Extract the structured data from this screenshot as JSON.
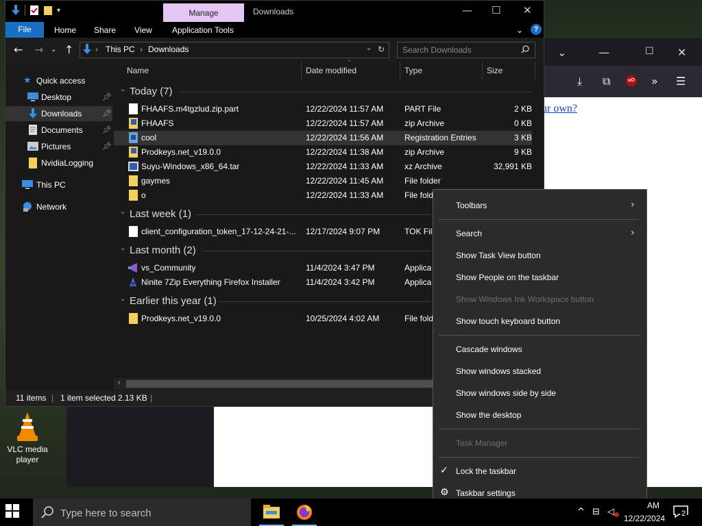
{
  "explorer": {
    "title": "Downloads",
    "manage_tab": "Manage",
    "ribbon_tabs": [
      "File",
      "Home",
      "Share",
      "View",
      "Application Tools"
    ],
    "breadcrumb": [
      "This PC",
      "Downloads"
    ],
    "search_placeholder": "Search Downloads",
    "columns": [
      "Name",
      "Date modified",
      "Type",
      "Size"
    ],
    "sidebar": [
      {
        "label": "Quick access",
        "icon": "star-icon"
      },
      {
        "label": "Desktop",
        "icon": "desktop-icon",
        "pinned": true
      },
      {
        "label": "Downloads",
        "icon": "download-icon",
        "pinned": true,
        "selected": true
      },
      {
        "label": "Documents",
        "icon": "document-icon",
        "pinned": true
      },
      {
        "label": "Pictures",
        "icon": "pictures-icon",
        "pinned": true
      },
      {
        "label": "NvidiaLogging",
        "icon": "folder-icon"
      },
      {
        "label": "This PC",
        "icon": "pc-icon"
      },
      {
        "label": "Network",
        "icon": "network-icon"
      }
    ],
    "groups": [
      {
        "label": "Today (7)",
        "files": [
          {
            "name": "FHAAFS.m4tgzlud.zip.part",
            "date": "12/22/2024 11:57 AM",
            "type": "PART File",
            "size": "2 KB",
            "icon": "file-icon"
          },
          {
            "name": "FHAAFS",
            "date": "12/22/2024 11:57 AM",
            "type": "zip Archive",
            "size": "0 KB",
            "icon": "zip-icon"
          },
          {
            "name": "cool",
            "date": "12/22/2024 11:56 AM",
            "type": "Registration Entries",
            "size": "3 KB",
            "icon": "registry-icon"
          },
          {
            "name": "Prodkeys.net_v19.0.0",
            "date": "12/22/2024 11:38 AM",
            "type": "zip Archive",
            "size": "9 KB",
            "icon": "zip-icon"
          },
          {
            "name": "Suyu-Windows_x86_64.tar",
            "date": "12/22/2024 11:33 AM",
            "type": "xz Archive",
            "size": "32,991 KB",
            "icon": "archive-icon"
          },
          {
            "name": "gaymes",
            "date": "12/22/2024 11:45 AM",
            "type": "File folder",
            "size": "",
            "icon": "folder-icon"
          },
          {
            "name": "o",
            "date": "12/22/2024 11:33 AM",
            "type": "File fold",
            "size": "",
            "icon": "folder-icon"
          }
        ]
      },
      {
        "label": "Last week (1)",
        "files": [
          {
            "name": "client_configuration_token_17-12-24-21-...",
            "date": "12/17/2024 9:07 PM",
            "type": "TOK File",
            "size": "",
            "icon": "file-icon"
          }
        ]
      },
      {
        "label": "Last month (2)",
        "files": [
          {
            "name": "vs_Community",
            "date": "11/4/2024 3:47 PM",
            "type": "Applica",
            "size": "",
            "icon": "vs-icon"
          },
          {
            "name": "Ninite 7Zip Everything Firefox Installer",
            "date": "11/4/2024 3:42 PM",
            "type": "Applica",
            "size": "",
            "icon": "ninite-icon"
          }
        ]
      },
      {
        "label": "Earlier this year (1)",
        "files": [
          {
            "name": "Prodkeys.net_v19.0.0",
            "date": "10/25/2024 4:02 AM",
            "type": "File fold",
            "size": "",
            "icon": "folder-icon"
          }
        ]
      }
    ],
    "status": {
      "items": "11 items",
      "selected": "1 item selected",
      "size": "2.13 KB"
    }
  },
  "browser": {
    "link_text": "ur own?"
  },
  "desktop": {
    "vlc_label": "VLC media player"
  },
  "context_menu": {
    "items": [
      {
        "label": "Toolbars",
        "submenu": true,
        "enabled": true
      },
      {
        "label": "Search",
        "submenu": true,
        "enabled": true
      },
      {
        "label": "Show Task View button",
        "enabled": true
      },
      {
        "label": "Show People on the taskbar",
        "enabled": true
      },
      {
        "label": "Show Windows Ink Workspace button",
        "enabled": false
      },
      {
        "label": "Show touch keyboard button",
        "enabled": true
      },
      {
        "label": "Cascade windows",
        "enabled": true
      },
      {
        "label": "Show windows stacked",
        "enabled": true
      },
      {
        "label": "Show windows side by side",
        "enabled": true
      },
      {
        "label": "Show the desktop",
        "enabled": true
      },
      {
        "label": "Task Manager",
        "enabled": false
      },
      {
        "label": "Lock the taskbar",
        "checked": true,
        "enabled": true
      },
      {
        "label": "Taskbar settings",
        "icon": "gear-icon",
        "enabled": true
      }
    ]
  },
  "taskbar": {
    "search_placeholder": "Type here to search",
    "clock_time": "AM",
    "clock_date": "12/22/2024",
    "notification_count": "2"
  },
  "colors": {
    "accent": "#1a6fc5",
    "manage_tab": "#e3c8f4",
    "folder": "#f3cf5c"
  }
}
